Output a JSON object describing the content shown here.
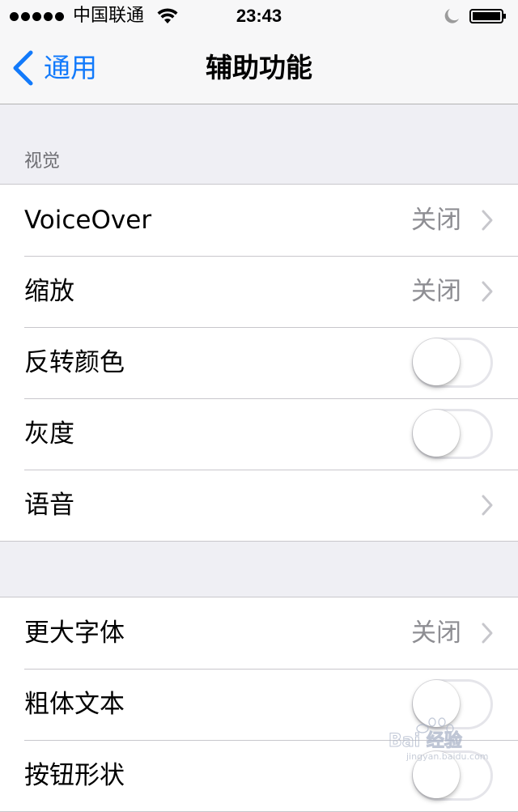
{
  "status_bar": {
    "carrier": "中国联通",
    "time": "23:43"
  },
  "nav": {
    "back_label": "通用",
    "title": "辅助功能"
  },
  "vision": {
    "header": "视觉",
    "rows": [
      {
        "label": "VoiceOver",
        "value": "关闭",
        "control": "disclosure"
      },
      {
        "label": "缩放",
        "value": "关闭",
        "control": "disclosure"
      },
      {
        "label": "反转颜色",
        "control": "switch",
        "on": false
      },
      {
        "label": "灰度",
        "control": "switch",
        "on": false
      },
      {
        "label": "语音",
        "control": "disclosure"
      }
    ]
  },
  "text_group": {
    "rows": [
      {
        "label": "更大字体",
        "value": "关闭",
        "control": "disclosure"
      },
      {
        "label": "粗体文本",
        "control": "switch",
        "on": false
      },
      {
        "label": "按钮形状",
        "control": "switch",
        "on": false
      }
    ]
  },
  "watermark": {
    "text": "Bai 经验",
    "subtext": "jingyan.baidu.com"
  },
  "colors": {
    "accent": "#127afb",
    "background": "#efeff4",
    "separator": "#c8c7cc",
    "secondary_text": "#8e8e93",
    "switch_border": "#e5e5ea"
  },
  "icons": {
    "signal": "signal-dots-icon",
    "wifi": "wifi-icon",
    "moon": "do-not-disturb-moon-icon",
    "battery": "battery-icon",
    "back": "chevron-left-icon",
    "disclosure": "chevron-right-icon"
  }
}
